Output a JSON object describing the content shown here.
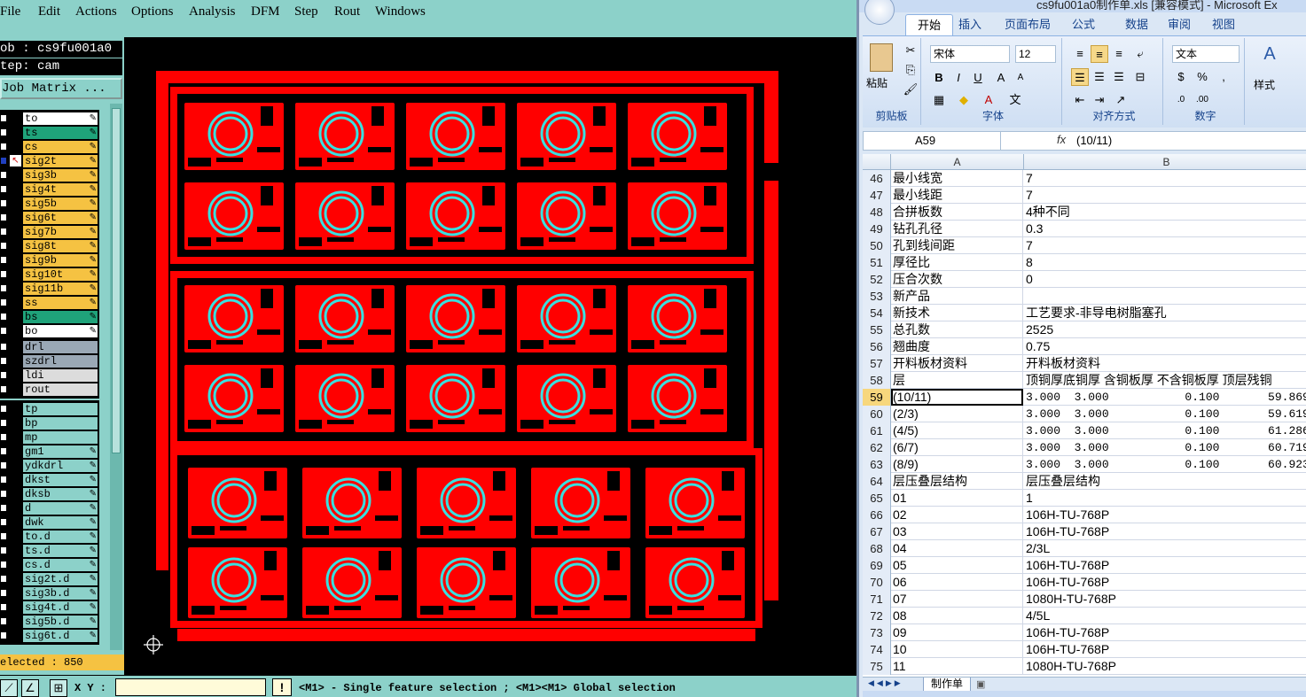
{
  "cam": {
    "menu": [
      "File",
      "Edit",
      "Actions",
      "Options",
      "Analysis",
      "DFM",
      "Step",
      "Rout",
      "Windows"
    ],
    "job_line": "ob : cs9fu001a0",
    "step_line": "tep: cam",
    "matrix_button": "Job Matrix ...",
    "layer_groups": [
      [
        {
          "name": "to",
          "color": "#ffffff"
        },
        {
          "name": "ts",
          "color": "#1fa37a"
        },
        {
          "name": "cs",
          "color": "#f5c242"
        },
        {
          "name": "sig2t",
          "color": "#f5c242"
        },
        {
          "name": "sig3b",
          "color": "#f5c242"
        },
        {
          "name": "sig4t",
          "color": "#f5c242"
        },
        {
          "name": "sig5b",
          "color": "#f5c242"
        },
        {
          "name": "sig6t",
          "color": "#f5c242"
        },
        {
          "name": "sig7b",
          "color": "#f5c242"
        },
        {
          "name": "sig8t",
          "color": "#f5c242"
        },
        {
          "name": "sig9b",
          "color": "#f5c242"
        },
        {
          "name": "sig10t",
          "color": "#f5c242"
        },
        {
          "name": "sig11b",
          "color": "#f5c242"
        },
        {
          "name": "ss",
          "color": "#f5c242"
        },
        {
          "name": "bs",
          "color": "#1fa37a"
        },
        {
          "name": "bo",
          "color": "#ffffff"
        }
      ],
      [
        {
          "name": "drl",
          "color": "#9aa8b5"
        },
        {
          "name": "szdrl",
          "color": "#9aa8b5"
        },
        {
          "name": "ldi",
          "color": "#dcdcdc"
        },
        {
          "name": "rout",
          "color": "#dcdcdc"
        }
      ],
      [
        {
          "name": "tp",
          "color": "#8cd1c9"
        },
        {
          "name": "bp",
          "color": "#8cd1c9"
        },
        {
          "name": "mp",
          "color": "#8cd1c9"
        },
        {
          "name": "gm1",
          "color": "#8cd1c9"
        },
        {
          "name": "ydkdrl",
          "color": "#8cd1c9"
        },
        {
          "name": "dkst",
          "color": "#8cd1c9"
        },
        {
          "name": "dksb",
          "color": "#8cd1c9"
        },
        {
          "name": "d",
          "color": "#8cd1c9"
        },
        {
          "name": "dwk",
          "color": "#8cd1c9"
        },
        {
          "name": "to.d",
          "color": "#8cd1c9"
        },
        {
          "name": "ts.d",
          "color": "#8cd1c9"
        },
        {
          "name": "cs.d",
          "color": "#8cd1c9"
        },
        {
          "name": "sig2t.d",
          "color": "#8cd1c9"
        },
        {
          "name": "sig3b.d",
          "color": "#8cd1c9"
        },
        {
          "name": "sig4t.d",
          "color": "#8cd1c9"
        },
        {
          "name": "sig5b.d",
          "color": "#8cd1c9"
        },
        {
          "name": "sig6t.d",
          "color": "#8cd1c9"
        }
      ]
    ],
    "selected_status": "elected : 850",
    "xy_label": "X Y :",
    "status_message": "<M1> - Single feature selection ; <M1><M1> Global selection",
    "colors": {
      "copper": "#ff0000",
      "drill": "#38e0e0",
      "panel": "#8cd1c9"
    }
  },
  "excel": {
    "title": "cs9fu001a0制作单.xls  [兼容模式] - Microsoft Ex",
    "tabs": [
      "开始",
      "插入",
      "页面布局",
      "公式",
      "数据",
      "审阅",
      "视图"
    ],
    "ribbon": {
      "paste": "粘贴",
      "clipboard": "剪贴板",
      "font_name": "宋体",
      "font_size": "12",
      "font_group": "字体",
      "align_group": "对齐方式",
      "number_format": "文本",
      "number_group": "数字",
      "style": "样式"
    },
    "name_box": "A59",
    "formula": "(10/11)",
    "columns": [
      "A",
      "B"
    ],
    "rows": [
      {
        "n": "46",
        "a": "最小线宽",
        "b": "7"
      },
      {
        "n": "47",
        "a": "最小线距",
        "b": "7"
      },
      {
        "n": "48",
        "a": "合拼板数",
        "b": "4种不同"
      },
      {
        "n": "49",
        "a": "钻孔孔径",
        "b": "0.3"
      },
      {
        "n": "50",
        "a": "孔到线间距",
        "b": "7"
      },
      {
        "n": "51",
        "a": "厚径比",
        "b": "8"
      },
      {
        "n": "52",
        "a": "压合次数",
        "b": "0"
      },
      {
        "n": "53",
        "a": "新产品",
        "b": ""
      },
      {
        "n": "54",
        "a": "新技术",
        "b": "工艺要求-非导电树脂塞孔"
      },
      {
        "n": "55",
        "a": "总孔数",
        "b": "2525"
      },
      {
        "n": "56",
        "a": "翘曲度",
        "b": "0.75"
      },
      {
        "n": "57",
        "a": "开料板材资料",
        "b": "开料板材资料"
      },
      {
        "n": "58",
        "a": "层",
        "b": "顶铜厚底铜厚 含铜板厚 不含铜板厚 顶层残铜"
      },
      {
        "n": "59",
        "a": "(10/11)",
        "b": "3.000  3.000           0.100       59.869"
      },
      {
        "n": "60",
        "a": "(2/3)",
        "b": "3.000  3.000           0.100       59.619"
      },
      {
        "n": "61",
        "a": "(4/5)",
        "b": "3.000  3.000           0.100       61.286"
      },
      {
        "n": "62",
        "a": "(6/7)",
        "b": "3.000  3.000           0.100       60.719"
      },
      {
        "n": "63",
        "a": "(8/9)",
        "b": "3.000  3.000           0.100       60.923"
      },
      {
        "n": "64",
        "a": "层压叠层结构",
        "b": "层压叠层结构"
      },
      {
        "n": "65",
        "a": "01",
        "b": "1"
      },
      {
        "n": "66",
        "a": "02",
        "b": "106H-TU-768P"
      },
      {
        "n": "67",
        "a": "03",
        "b": "106H-TU-768P"
      },
      {
        "n": "68",
        "a": "04",
        "b": "2/3L"
      },
      {
        "n": "69",
        "a": "05",
        "b": "106H-TU-768P"
      },
      {
        "n": "70",
        "a": "06",
        "b": "106H-TU-768P"
      },
      {
        "n": "71",
        "a": "07",
        "b": "1080H-TU-768P"
      },
      {
        "n": "72",
        "a": "08",
        "b": "4/5L"
      },
      {
        "n": "73",
        "a": "09",
        "b": "106H-TU-768P"
      },
      {
        "n": "74",
        "a": "10",
        "b": "106H-TU-768P"
      },
      {
        "n": "75",
        "a": "11",
        "b": "1080H-TU-768P"
      }
    ],
    "selected_row": "59",
    "sheet_tab": "制作单"
  }
}
